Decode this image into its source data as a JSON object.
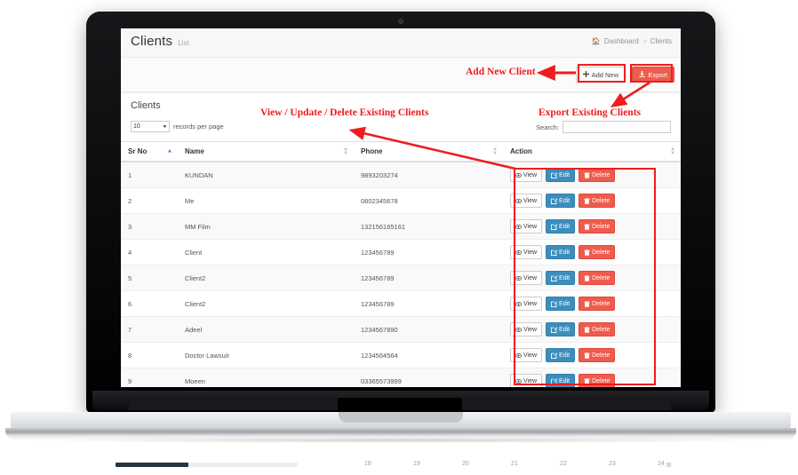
{
  "page": {
    "title": "Clients",
    "subtitle": "List"
  },
  "breadcrumb": {
    "home_icon": "home-icon",
    "items": [
      "Dashboard",
      "Clients"
    ],
    "separator": ">"
  },
  "toolbar": {
    "add_new_label": "Add New",
    "add_new_icon": "plus-icon",
    "export_label": "Export",
    "export_icon": "download-icon"
  },
  "card": {
    "title": "Clients"
  },
  "controls": {
    "records_value": "10",
    "records_label": "records per page",
    "search_label": "Search:",
    "search_value": "",
    "search_placeholder": ""
  },
  "table": {
    "columns": [
      "Sr No",
      "Name",
      "Phone",
      "Action"
    ],
    "sorted_column": "Sr No",
    "sort_direction": "asc",
    "rows": [
      {
        "srno": "1",
        "name": "KUNDAN",
        "phone": "9893203274"
      },
      {
        "srno": "2",
        "name": "Me",
        "phone": "0802345678"
      },
      {
        "srno": "3",
        "name": "MM Film",
        "phone": "132156165161"
      },
      {
        "srno": "4",
        "name": "Client",
        "phone": "123456789"
      },
      {
        "srno": "5",
        "name": "Client2",
        "phone": "123456789"
      },
      {
        "srno": "6",
        "name": "Client2",
        "phone": "123456789"
      },
      {
        "srno": "7",
        "name": "Adeel",
        "phone": "1234567890"
      },
      {
        "srno": "8",
        "name": "Doctor Lawsuit",
        "phone": "1234564564"
      },
      {
        "srno": "9",
        "name": "Moeen",
        "phone": "03365573999"
      }
    ],
    "row_actions": {
      "view_label": "View",
      "view_icon": "eye-icon",
      "edit_label": "Edit",
      "edit_icon": "pencil-square-icon",
      "delete_label": "Delete",
      "delete_icon": "trash-icon"
    }
  },
  "annotations": {
    "add_new_client": "Add New Client",
    "view_update_delete": "View / Update / Delete Existing Clients",
    "export_existing": "Export Existing Clients",
    "color": "#ee1c20"
  },
  "bottom_bar": {
    "ticks": [
      "18",
      "19",
      "20",
      "21",
      "22",
      "23",
      "24"
    ],
    "progress_percent": "40"
  },
  "colors": {
    "edit_blue": "#3c8dbc",
    "delete_red": "#ef5b4c",
    "annotation_red": "#ee1c20",
    "sort_active": "#5a5fd6"
  }
}
